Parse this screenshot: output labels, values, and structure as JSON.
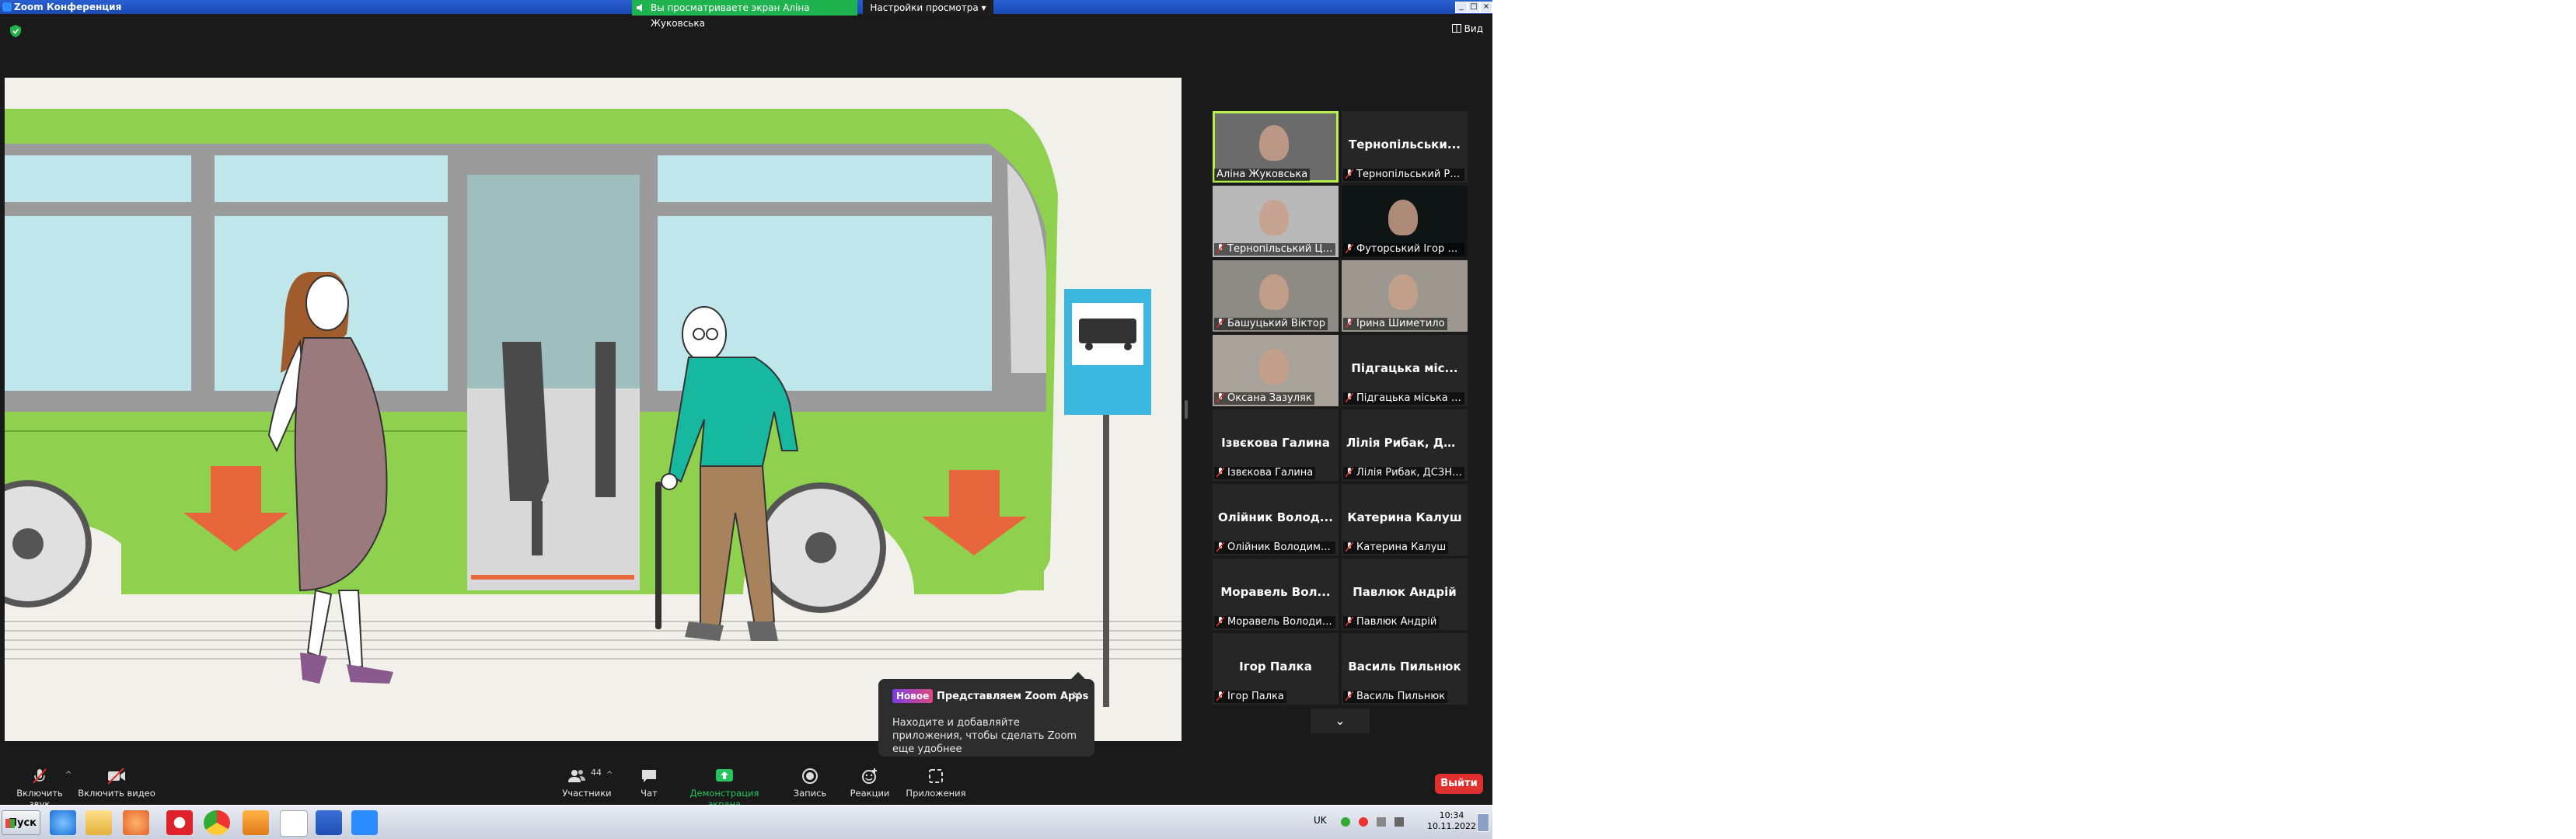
{
  "window": {
    "title": "Zoom Конференция"
  },
  "share_banner": {
    "text": "Вы просматриваете экран Аліна Жуковська"
  },
  "view_options": {
    "label": "Настройки просмотра"
  },
  "view_button": {
    "label": "Вид"
  },
  "gallery": {
    "tiles": [
      {
        "label": "Аліна Жуковська",
        "big": "",
        "video": true,
        "active": true,
        "muted": false
      },
      {
        "label": "Тернопільський РЦП",
        "big": "Тернопільськи...",
        "video": false,
        "active": false,
        "muted": true
      },
      {
        "label": "Тернопільський Цен...",
        "big": "",
        "video": true,
        "active": false,
        "muted": true
      },
      {
        "label": "Футорський Ігор Оле...",
        "big": "",
        "video": true,
        "active": false,
        "muted": true
      },
      {
        "label": "Башуцький Віктор",
        "big": "",
        "video": true,
        "active": false,
        "muted": true
      },
      {
        "label": "Ірина Шиметило",
        "big": "",
        "video": true,
        "active": false,
        "muted": true
      },
      {
        "label": "Оксана Зазуляк",
        "big": "",
        "video": true,
        "active": false,
        "muted": true
      },
      {
        "label": "Підгацька міська ра...",
        "big": "Підгацька міс...",
        "video": false,
        "active": false,
        "muted": true
      },
      {
        "label": "Ізвєкова Галина",
        "big": "Ізвєкова Галина",
        "video": false,
        "active": false,
        "muted": true
      },
      {
        "label": "Лілія Рибак, ДСЗН Т...",
        "big": "Лілія Рибак, ДС...",
        "video": false,
        "active": false,
        "muted": true
      },
      {
        "label": "Олійник Володимир ...",
        "big": "Олійник Волод...",
        "video": false,
        "active": false,
        "muted": true
      },
      {
        "label": "Катерина Калуш",
        "big": "Катерина Калуш",
        "video": false,
        "active": false,
        "muted": true
      },
      {
        "label": "Моравель Володим...",
        "big": "Моравель Вол...",
        "video": false,
        "active": false,
        "muted": true
      },
      {
        "label": "Павлюк Андрій",
        "big": "Павлюк Андрій",
        "video": false,
        "active": false,
        "muted": true
      },
      {
        "label": "Ігор Палка",
        "big": "Ігор Палка",
        "video": false,
        "active": false,
        "muted": true
      },
      {
        "label": "Василь Пильнюк",
        "big": "Василь Пильнюк",
        "video": false,
        "active": false,
        "muted": true
      }
    ]
  },
  "popup": {
    "badge": "Новое",
    "title": "Представляем Zoom Apps",
    "body": "Находите и добавляйте приложения, чтобы сделать Zoom еще удобнее"
  },
  "toolbar": {
    "audio": "Включить звук",
    "video": "Включить видео",
    "participants": "Участники",
    "participants_count": "44",
    "chat": "Чат",
    "share": "Демонстрация экрана",
    "record": "Запись",
    "reactions": "Реакции",
    "apps": "Приложения",
    "leave": "Выйти"
  },
  "taskbar": {
    "start": "Пуск",
    "lang": "UK",
    "time": "10:34",
    "date": "10.11.2022"
  },
  "colors": {
    "bus_green": "#8fd14f",
    "share_green": "#1eb34e",
    "leave_red": "#e02f2f",
    "active_tile": "#b5f04c"
  }
}
